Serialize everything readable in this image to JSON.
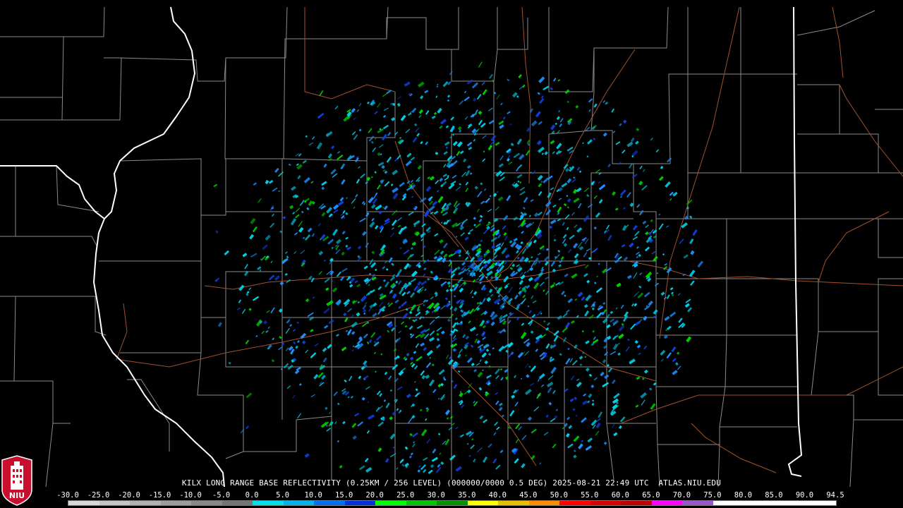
{
  "caption": "KILX LONG RANGE BASE REFLECTIVITY (0.25KM / 256 LEVEL) (000000/0000 0.5 DEG) 2025-08-21 22:49 UTC  ATLAS.NIU.EDU",
  "logo": {
    "text": "NIU",
    "icon": "niu-university-tower-logo",
    "color": "#c8102e"
  },
  "scale": {
    "labels": [
      "-30.0",
      "-25.0",
      "-20.0",
      "-15.0",
      "-10.0",
      "-5.0",
      "0.0",
      "5.0",
      "10.0",
      "15.0",
      "20.0",
      "25.0",
      "30.0",
      "35.0",
      "40.0",
      "45.0",
      "50.0",
      "55.0",
      "60.0",
      "65.0",
      "70.0",
      "75.0",
      "80.0",
      "85.0",
      "90.0",
      "94.5"
    ],
    "colors": [
      "#d8d8d8",
      "#c4c4c4",
      "#b0b0b0",
      "#9c9c9c",
      "#888888",
      "#747474",
      "#00e0e8",
      "#00b4f0",
      "#0070f0",
      "#0030d8",
      "#00ff00",
      "#00c800",
      "#009000",
      "#ffff00",
      "#e8c000",
      "#ff8c00",
      "#ff0000",
      "#d60000",
      "#c00000",
      "#ff00ff",
      "#9955c9",
      "#ffffff",
      "#ffffff",
      "#ffffff",
      "#ffffff"
    ]
  },
  "colors": {
    "background": "#000000",
    "county_lines": "#8a8a8a",
    "state_lines": "#ffffff",
    "highways": "#a0522d",
    "echo_light": "#00d0e8",
    "echo_mid": "#1e90ff",
    "echo_dark": "#1040e0",
    "echo_green": "#00d000"
  }
}
